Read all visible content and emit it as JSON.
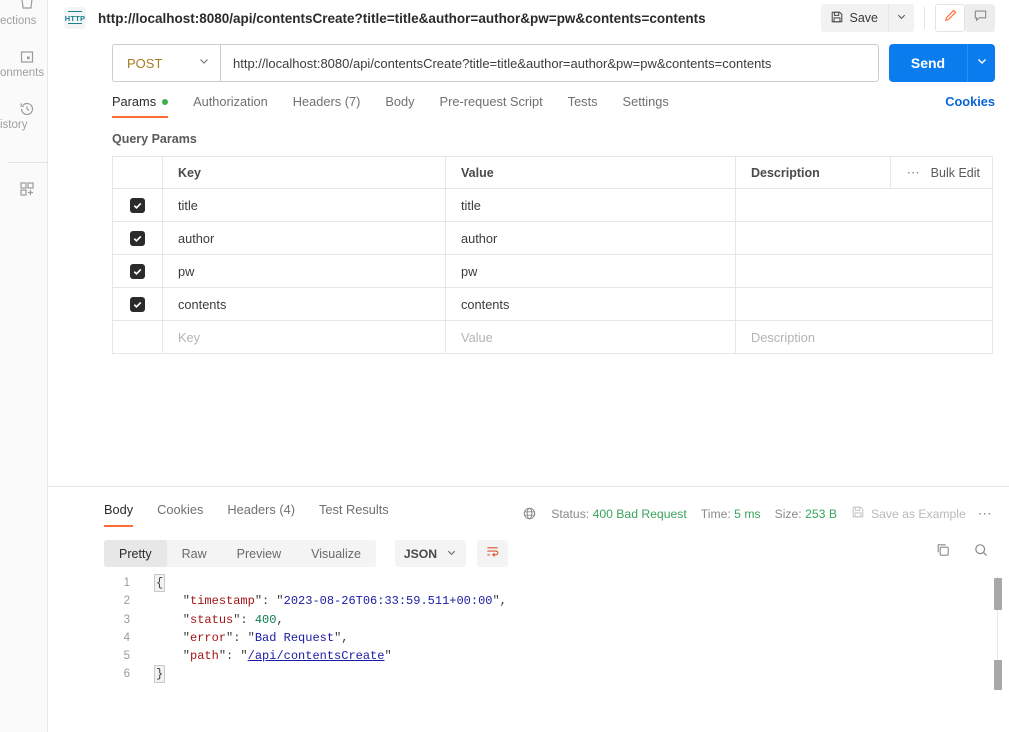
{
  "sidebar": {
    "items": [
      {
        "label": "ections",
        "icon": "collections-icon"
      },
      {
        "label": "onments",
        "icon": "environments-icon"
      },
      {
        "label": "istory",
        "icon": "history-icon"
      },
      {
        "label": "",
        "icon": "new-grid-icon"
      }
    ]
  },
  "namebar": {
    "protocol_badge": "HTTP",
    "request_title": "http://localhost:8080/api/contentsCreate?title=title&author=author&pw=pw&contents=contents",
    "save_label": "Save",
    "save_caret_icon": "chevron-down-icon",
    "save_icon": "floppy-disk-icon",
    "edit_icon": "pencil-icon",
    "comment_icon": "comment-icon"
  },
  "request": {
    "method": "POST",
    "method_caret_icon": "chevron-down-icon",
    "url": "http://localhost:8080/api/contentsCreate?title=title&author=author&pw=pw&contents=contents",
    "send_label": "Send",
    "send_caret_icon": "chevron-down-icon",
    "tabs": [
      {
        "label": "Params",
        "selected": true,
        "dot": true
      },
      {
        "label": "Authorization",
        "selected": false,
        "dot": false
      },
      {
        "label": "Headers (7)",
        "selected": false,
        "dot": false
      },
      {
        "label": "Body",
        "selected": false,
        "dot": false
      },
      {
        "label": "Pre-request Script",
        "selected": false,
        "dot": false
      },
      {
        "label": "Tests",
        "selected": false,
        "dot": false
      },
      {
        "label": "Settings",
        "selected": false,
        "dot": false
      }
    ],
    "cookies_label": "Cookies"
  },
  "query_params": {
    "section_title": "Query Params",
    "headers": {
      "key": "Key",
      "value": "Value",
      "description": "Description",
      "bulk_edit": "Bulk Edit",
      "more_icon": "ellipsis-icon"
    },
    "rows": [
      {
        "checked": true,
        "key": "title",
        "value": "title",
        "description": ""
      },
      {
        "checked": true,
        "key": "author",
        "value": "author",
        "description": ""
      },
      {
        "checked": true,
        "key": "pw",
        "value": "pw",
        "description": ""
      },
      {
        "checked": true,
        "key": "contents",
        "value": "contents",
        "description": ""
      }
    ],
    "placeholder_row": {
      "key": "Key",
      "value": "Value",
      "description": "Description"
    }
  },
  "response": {
    "tabs": [
      {
        "label": "Body",
        "selected": true
      },
      {
        "label": "Cookies",
        "selected": false
      },
      {
        "label": "Headers (4)",
        "selected": false
      },
      {
        "label": "Test Results",
        "selected": false
      }
    ],
    "meta": {
      "globe_icon": "globe-icon",
      "status_label": "Status:",
      "status_value": "400 Bad Request",
      "time_label": "Time:",
      "time_value": "5 ms",
      "size_label": "Size:",
      "size_value": "253 B",
      "save_example_label": "Save as Example",
      "save_example_icon": "floppy-disk-icon",
      "more_icon": "ellipsis-icon"
    },
    "formats": [
      {
        "label": "Pretty",
        "selected": true
      },
      {
        "label": "Raw",
        "selected": false
      },
      {
        "label": "Preview",
        "selected": false
      },
      {
        "label": "Visualize",
        "selected": false
      }
    ],
    "language": "JSON",
    "language_caret_icon": "chevron-down-icon",
    "wrap_icon": "wrap-text-icon",
    "copy_icon": "copy-icon",
    "search_icon": "search-icon",
    "body_lines": [
      {
        "no": "1",
        "type": "brace-open"
      },
      {
        "no": "2",
        "type": "kv-string",
        "key": "timestamp",
        "value": "2023-08-26T06:33:59.511+00:00",
        "comma": true
      },
      {
        "no": "3",
        "type": "kv-number",
        "key": "status",
        "value": "400",
        "comma": true
      },
      {
        "no": "4",
        "type": "kv-string",
        "key": "error",
        "value": "Bad Request",
        "comma": true
      },
      {
        "no": "5",
        "type": "kv-link",
        "key": "path",
        "value": "/api/contentsCreate",
        "comma": false
      },
      {
        "no": "6",
        "type": "brace-close"
      }
    ]
  },
  "colors": {
    "accent": "#ff6c37",
    "send_blue": "#0a7ced",
    "link_blue": "#0a66d6",
    "status_green": "#3aa35c",
    "method_post": "#a97a23",
    "json_key": "#a31515",
    "json_string": "#1a1aa6",
    "json_number": "#0c7a4d"
  }
}
